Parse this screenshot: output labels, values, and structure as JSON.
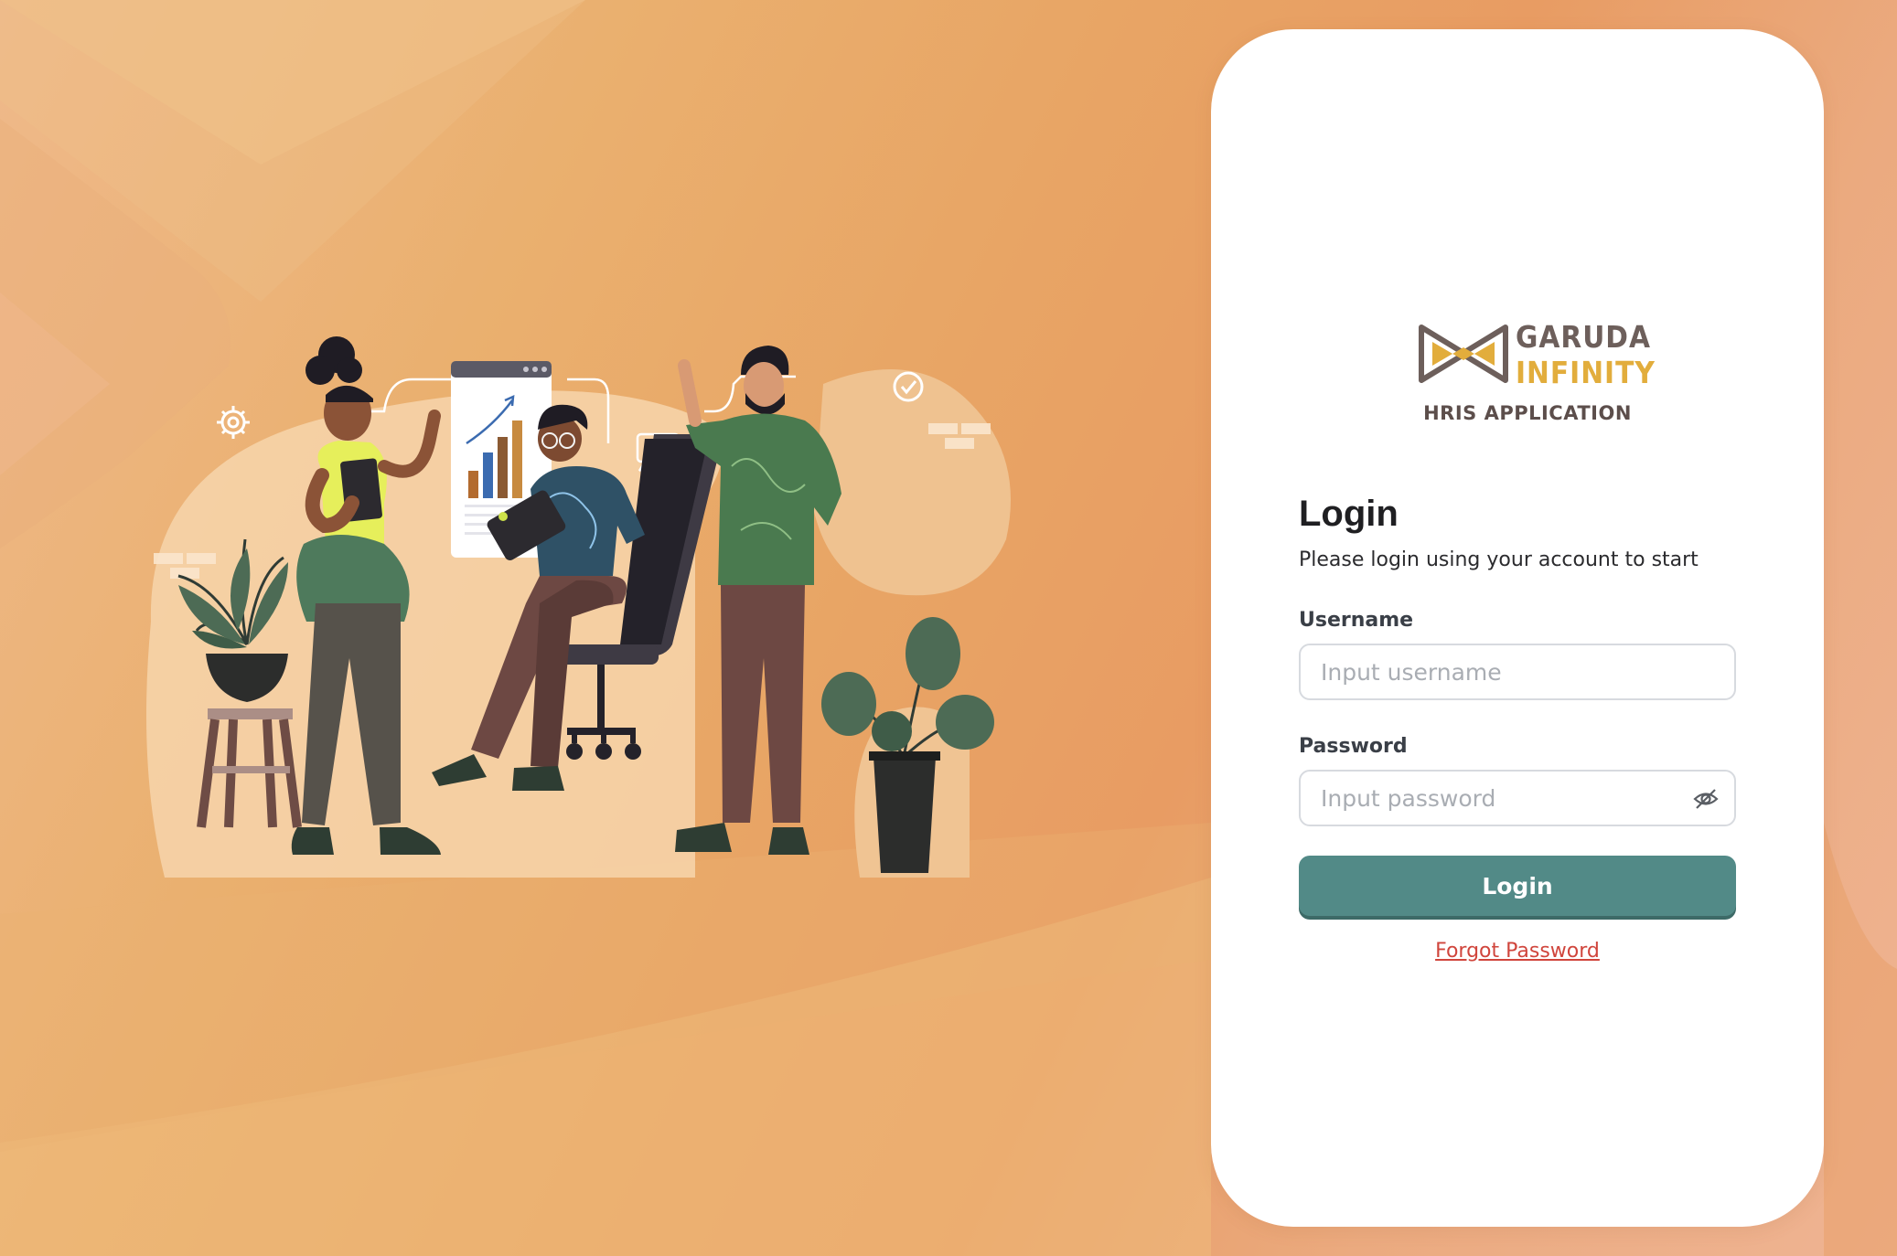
{
  "brand": {
    "name_line1": "GARUDA",
    "name_line2": "INFINITY",
    "subtitle": "HRIS APPLICATION",
    "colors": {
      "primary_dark": "#6d5f5b",
      "primary_gold": "#e2ad3c"
    }
  },
  "login": {
    "title": "Login",
    "subtitle": "Please login using your account to start",
    "username_label": "Username",
    "username_placeholder": "Input username",
    "username_value": "",
    "password_label": "Password",
    "password_placeholder": "Input password",
    "password_value": "",
    "password_toggle_icon": "eye-off-icon",
    "submit_label": "Login",
    "forgot_label": "Forgot Password"
  },
  "theme": {
    "background": "#e8a565",
    "button": "#528a87",
    "link": "#d0453c"
  },
  "illustration": {
    "description_icons": [
      "gear-icon",
      "chat-bubble-icon",
      "check-circle-icon",
      "bar-chart-icon",
      "laptop-icon",
      "plant-icon",
      "office-chair-icon"
    ]
  }
}
